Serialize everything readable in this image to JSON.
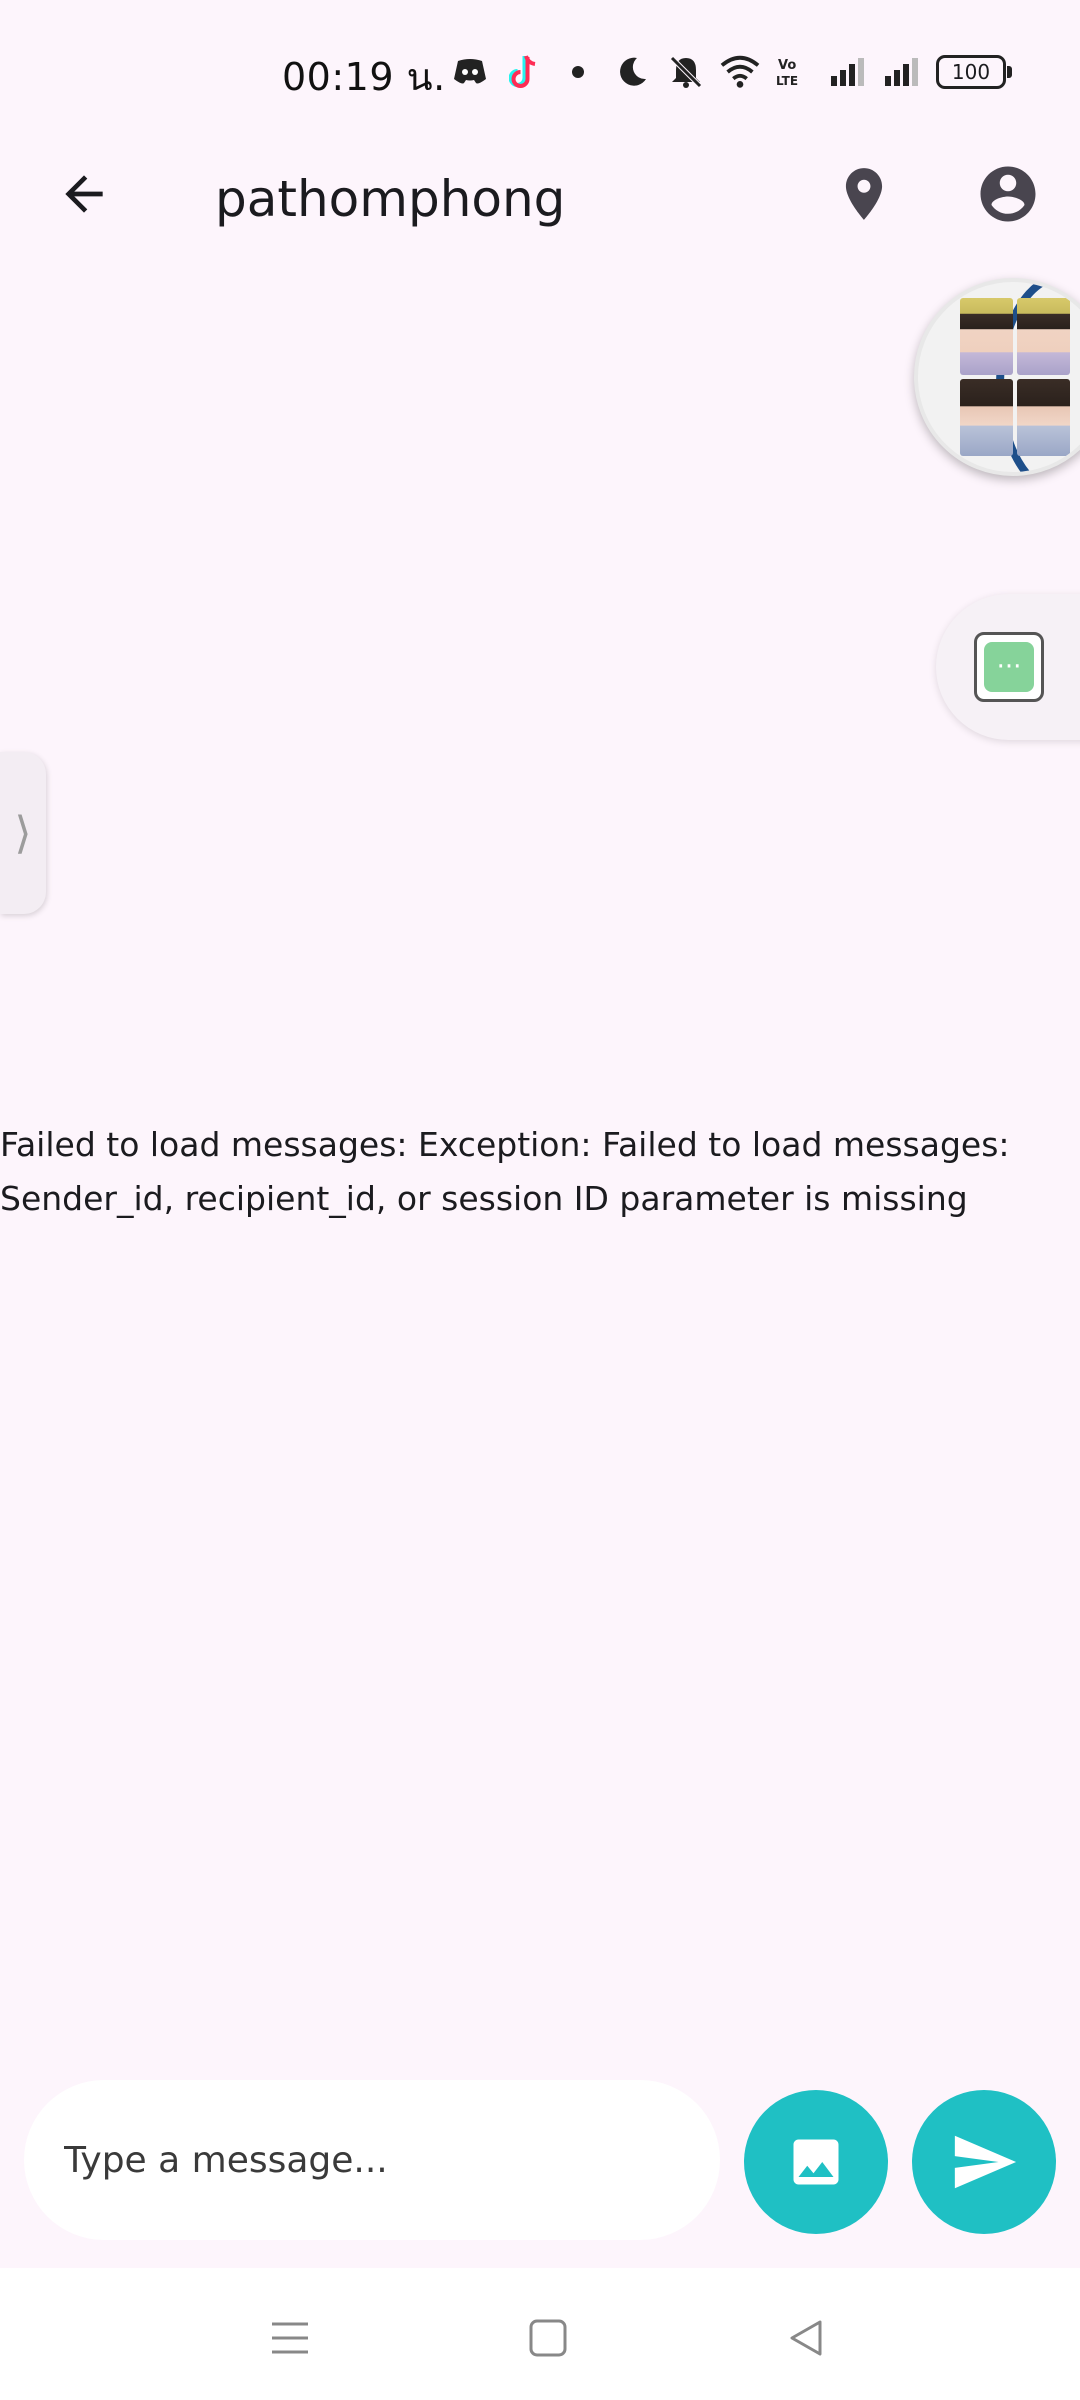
{
  "status_bar": {
    "time": "00:19 น.",
    "battery": "100",
    "icons": [
      "discord-icon",
      "tiktok-icon",
      "dot-icon",
      "moon-icon",
      "bell-off-icon",
      "wifi-icon",
      "volte-icon",
      "signal-icon",
      "signal-icon",
      "battery-icon"
    ]
  },
  "app_bar": {
    "title": "pathomphong",
    "icons": [
      "back-arrow-icon",
      "location-pin-icon",
      "account-circle-icon"
    ]
  },
  "floating": {
    "chat_icon_text": "···",
    "edge_handle": "⟩"
  },
  "messages": {
    "error": "Failed to load messages: Exception: Failed to load messages: Sender_id, recipient_id, or session ID parameter is missing"
  },
  "composer": {
    "placeholder": "Type a message...",
    "value": "",
    "icons": [
      "image-icon",
      "send-icon"
    ]
  },
  "colors": {
    "background": "#fdf5fc",
    "accent": "#1fc0c4",
    "chat_green": "#86d39a"
  },
  "nav_bar": {
    "icons": [
      "menu-icon",
      "home-square-icon",
      "back-triangle-icon"
    ]
  }
}
